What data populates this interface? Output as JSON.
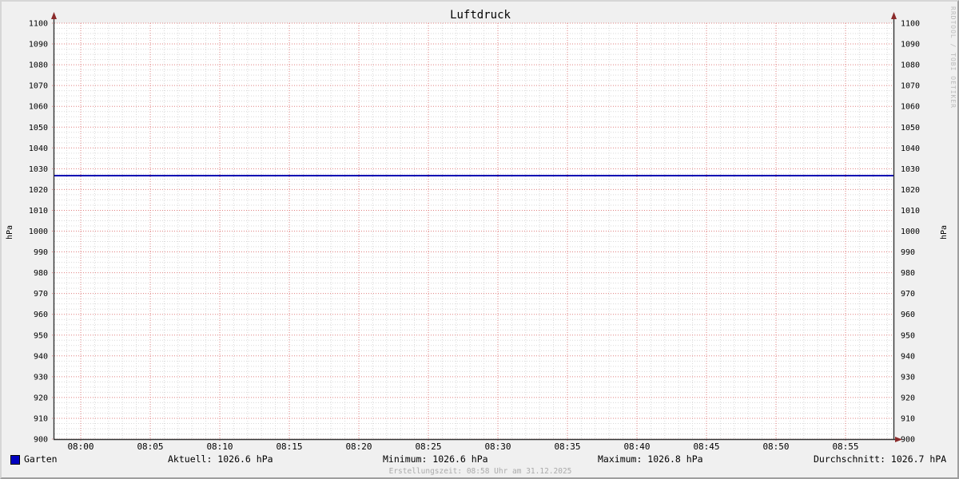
{
  "title": "Luftdruck",
  "watermark": "RRDTOOL / TOBI OETIKER",
  "y_axis": {
    "label_left": "hPa",
    "label_right": "hPa"
  },
  "legend": {
    "label": "Garten",
    "color": "#0000c0"
  },
  "stats": {
    "aktuell": "Aktuell: 1026.6 hPa",
    "minimum": "Minimum: 1026.6 hPa",
    "maximum": "Maximum: 1026.8 hPa",
    "durchschnitt": "Durchschnitt: 1026.7 hPA"
  },
  "footer": "Erstellungszeit: 08:58 Uhr am 31.12.2025",
  "chart_data": {
    "type": "line",
    "title": "Luftdruck",
    "xlabel": "",
    "ylabel": "hPa",
    "ylim": [
      900,
      1100
    ],
    "y_major_step": 10,
    "y_minor_step": 2.5,
    "x_tick_labels": [
      "08:00",
      "08:05",
      "08:10",
      "08:15",
      "08:20",
      "08:25",
      "08:30",
      "08:35",
      "08:40",
      "08:45",
      "08:50",
      "08:55"
    ],
    "x_major_step_minutes": 5,
    "x_minor_step_minutes": 1,
    "x_minutes_before_first_tick": 1,
    "x_minutes_after_last_tick": 3,
    "grid": true,
    "legend_position": "bottom",
    "series": [
      {
        "name": "Garten",
        "color": "#0000b3",
        "line_width": 2,
        "values": [
          1026.7,
          1026.7,
          1026.7,
          1026.7,
          1026.7,
          1026.7,
          1026.7,
          1026.7,
          1026.7,
          1026.7,
          1026.7,
          1026.7
        ],
        "aktuell": 1026.6,
        "minimum": 1026.6,
        "maximum": 1026.8,
        "durchschnitt": 1026.7
      }
    ],
    "colors": {
      "background": "#f0f0f0",
      "canvas": "#ffffff",
      "grid_major": "#e08080",
      "grid_minor": "#d9d9d9",
      "axis": "#333333",
      "arrow": "#8a2a2a",
      "tick_text": "#000000"
    }
  }
}
